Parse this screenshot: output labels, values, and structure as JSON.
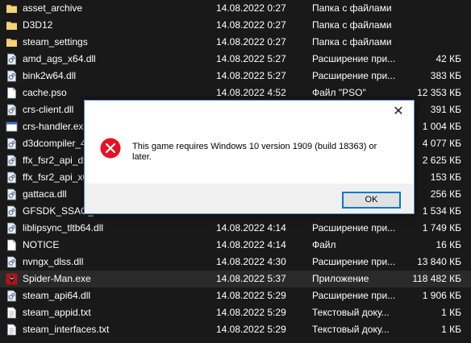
{
  "files": [
    {
      "name": "asset_archive",
      "date": "14.08.2022 0:27",
      "type": "Папка с файлами",
      "size": "",
      "icon": "folder-icon"
    },
    {
      "name": "D3D12",
      "date": "14.08.2022 0:27",
      "type": "Папка с файлами",
      "size": "",
      "icon": "folder-icon"
    },
    {
      "name": "steam_settings",
      "date": "14.08.2022 0:27",
      "type": "Папка с файлами",
      "size": "",
      "icon": "folder-icon"
    },
    {
      "name": "amd_ags_x64.dll",
      "date": "14.08.2022 5:27",
      "type": "Расширение при...",
      "size": "42 КБ",
      "icon": "dll-icon"
    },
    {
      "name": "bink2w64.dll",
      "date": "14.08.2022 5:27",
      "type": "Расширение при...",
      "size": "383 КБ",
      "icon": "dll-icon"
    },
    {
      "name": "cache.pso",
      "date": "14.08.2022 4:52",
      "type": "Файл \"PSO\"",
      "size": "12 353 КБ",
      "icon": "file-icon"
    },
    {
      "name": "crs-client.dll",
      "date": "",
      "type": "",
      "size": "391 КБ",
      "icon": "dll-icon"
    },
    {
      "name": "crs-handler.ex",
      "date": "",
      "type": "",
      "size": "1 004 КБ",
      "icon": "exe-icon"
    },
    {
      "name": "d3dcompiler_4",
      "date": "",
      "type": "",
      "size": "4 077 КБ",
      "icon": "dll-icon"
    },
    {
      "name": "ffx_fsr2_api_dx",
      "date": "",
      "type": "",
      "size": "2 625 КБ",
      "icon": "dll-icon"
    },
    {
      "name": "ffx_fsr2_api_x6",
      "date": "",
      "type": "",
      "size": "153 КБ",
      "icon": "dll-icon"
    },
    {
      "name": "gattaca.dll",
      "date": "",
      "type": "",
      "size": "256 КБ",
      "icon": "dll-icon"
    },
    {
      "name": "GFSDK_SSAO_",
      "date": "",
      "type": "",
      "size": "1 534 КБ",
      "icon": "dll-icon"
    },
    {
      "name": "liblipsync_tltb64.dll",
      "date": "14.08.2022 4:14",
      "type": "Расширение при...",
      "size": "1 749 КБ",
      "icon": "dll-icon"
    },
    {
      "name": "NOTICE",
      "date": "14.08.2022 4:14",
      "type": "Файл",
      "size": "16 КБ",
      "icon": "file-icon"
    },
    {
      "name": "nvngx_dlss.dll",
      "date": "14.08.2022 4:30",
      "type": "Расширение при...",
      "size": "13 840 КБ",
      "icon": "dll-icon"
    },
    {
      "name": "Spider-Man.exe",
      "date": "14.08.2022 5:37",
      "type": "Приложение",
      "size": "118 482 КБ",
      "icon": "spiderman-app-icon",
      "selected": true
    },
    {
      "name": "steam_api64.dll",
      "date": "14.08.2022 5:29",
      "type": "Расширение при...",
      "size": "1 906 КБ",
      "icon": "dll-icon"
    },
    {
      "name": "steam_appid.txt",
      "date": "14.08.2022 5:29",
      "type": "Текстовый доку...",
      "size": "1 КБ",
      "icon": "txt-icon"
    },
    {
      "name": "steam_interfaces.txt",
      "date": "14.08.2022 5:29",
      "type": "Текстовый доку...",
      "size": "1 КБ",
      "icon": "txt-icon"
    }
  ],
  "dialog": {
    "message": "This game requires Windows 10 version 1909 (build 18363) or later.",
    "ok_label": "OK",
    "close_glyph": "✕"
  },
  "colors": {
    "background": "#191919",
    "text": "#ffffff",
    "selected_row": "#2a2a2a",
    "folder": "#e8c05a",
    "error_red": "#e81123",
    "accent_blue": "#0078d7"
  }
}
